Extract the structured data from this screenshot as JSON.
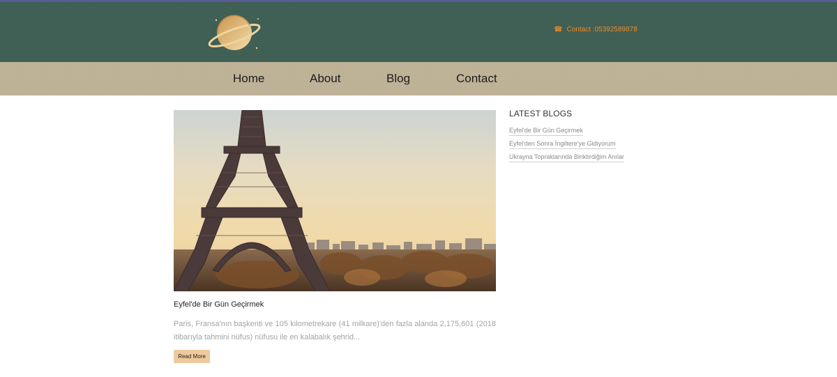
{
  "header": {
    "contact_label": "Contact :05392589878",
    "contact_icon": "phone-icon",
    "logo_icon": "planet-logo-icon"
  },
  "nav": {
    "items": [
      {
        "label": "Home"
      },
      {
        "label": "About"
      },
      {
        "label": "Blog"
      },
      {
        "label": "Contact"
      }
    ]
  },
  "post": {
    "image": "eiffel-tower-photo",
    "title": "Eyfel'de Bir Gün Geçirmek",
    "excerpt": "Paris, Fransa'nın başkenti ve 105 kilometrekare (41 milkare)'den fazla alanda 2,175,601 (2018 itibarıyla tahmini nüfus) nüfusu ile en kalabalık şehrid...",
    "read_more_label": "Read More"
  },
  "sidebar": {
    "heading": "LATEST BLOGS",
    "links": [
      {
        "label": "Eyfel'de Bir Gün Geçirmek"
      },
      {
        "label": "Eyfel'den Sonra İngiltere'ye Gidiyorum"
      },
      {
        "label": "Ukrayna Topraklarında Biriktirdiğim Anılar"
      }
    ]
  },
  "colors": {
    "header_bg": "#3e5e54",
    "nav_bg": "#bdb195",
    "accent": "#f08a24",
    "button_bg": "#efc99c"
  }
}
